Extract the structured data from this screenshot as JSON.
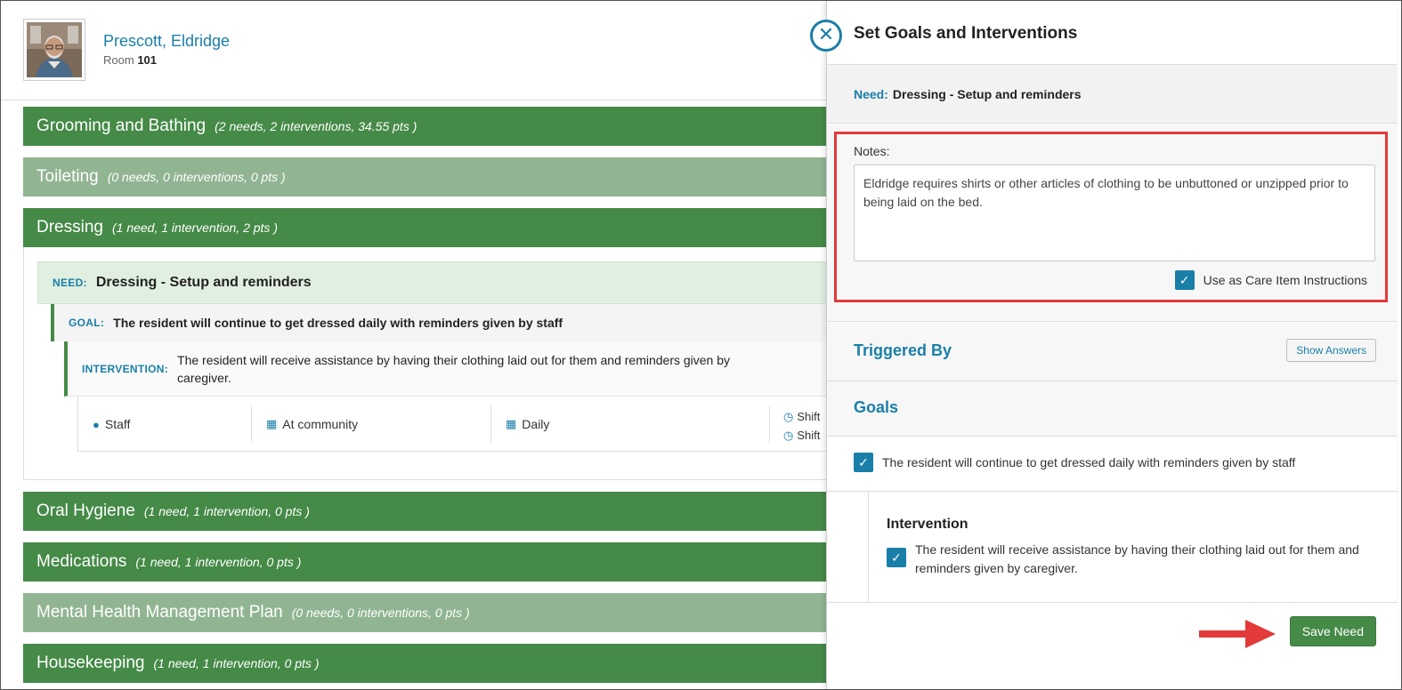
{
  "resident": {
    "name": "Prescott, Eldridge",
    "room_label": "Room",
    "room_number": "101"
  },
  "categories": [
    {
      "name": "Grooming and Bathing",
      "meta": "(2 needs, 2 interventions, 34.55 pts )"
    },
    {
      "name": "Toileting",
      "meta": "(0 needs, 0 interventions, 0 pts )"
    },
    {
      "name": "Dressing",
      "meta": "(1 need, 1 intervention, 2 pts )"
    },
    {
      "name": "Oral Hygiene",
      "meta": "(1 need, 1 intervention, 0 pts )"
    },
    {
      "name": "Medications",
      "meta": "(1 need, 1 intervention, 0 pts )"
    },
    {
      "name": "Mental Health Management Plan",
      "meta": "(0 needs, 0 interventions, 0 pts )"
    },
    {
      "name": "Housekeeping",
      "meta": "(1 need, 1 intervention, 0 pts )"
    }
  ],
  "dressing_detail": {
    "need_tag": "NEED:",
    "need_text": "Dressing - Setup and reminders",
    "goal_tag": "GOAL:",
    "goal_text": "The resident will continue to get dressed daily with reminders given by staff",
    "intervention_tag": "INTERVENTION:",
    "intervention_text": "The resident will receive assistance by having their clothing laid out for them and reminders given by caregiver.",
    "meta": {
      "staff": "Staff",
      "location": "At community",
      "frequency": "Daily",
      "shift1": "Shift",
      "shift2": "Shift"
    }
  },
  "panel": {
    "title": "Set Goals and Interventions",
    "need_label": "Need:",
    "need_value": "Dressing - Setup and reminders",
    "notes_label": "Notes:",
    "notes_value": "Eldridge requires shirts or other articles of clothing to be unbuttoned or unzipped prior to being laid on the bed.",
    "care_item_label": "Use as Care Item Instructions",
    "triggered_by": "Triggered By",
    "show_answers": "Show Answers",
    "goals_title": "Goals",
    "goal_item": "The resident will continue to get dressed daily with reminders given by staff",
    "intervention_title": "Intervention",
    "intervention_item": "The resident will receive assistance by having their clothing laid out for them and reminders given by caregiver.",
    "save_button": "Save Need"
  },
  "colors": {
    "accent": "#1a7fa8",
    "category_dark": "#458a47",
    "category_light": "#91b592",
    "highlight": "#e23a3a"
  }
}
